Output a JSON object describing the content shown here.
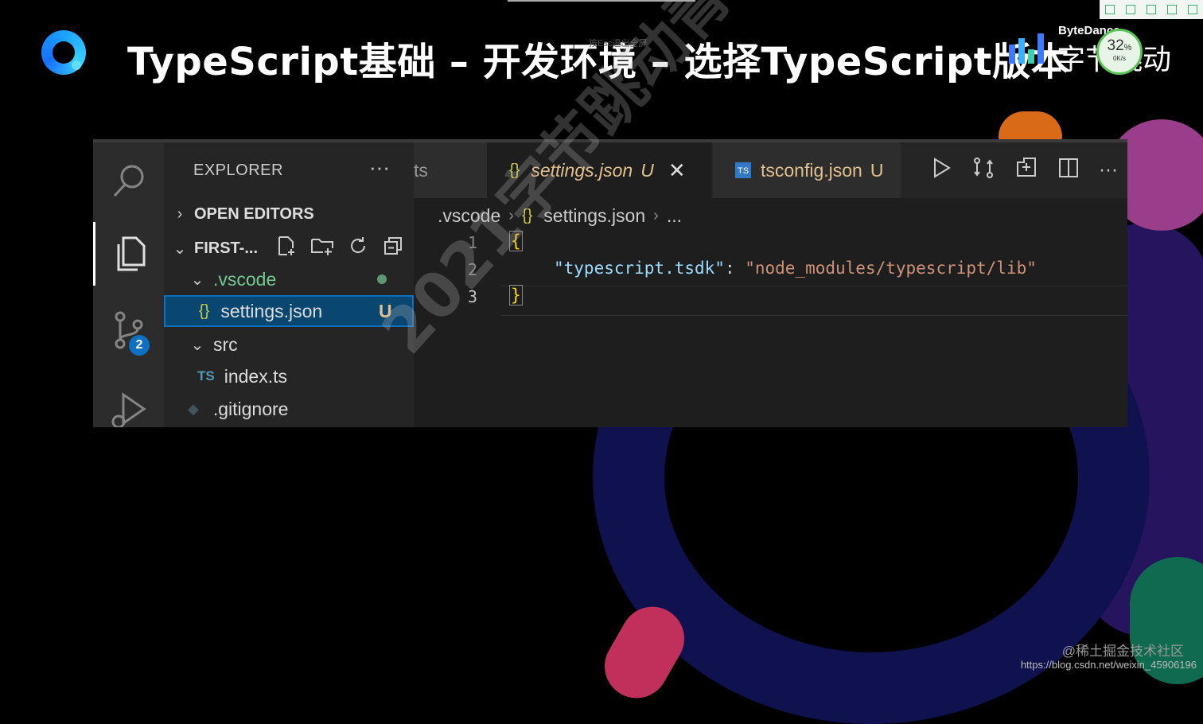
{
  "slide": {
    "title": "TypeScript基础 – 开发环境 – 选择TypeScript版本",
    "ghost_text": "按Esc退出全屏",
    "brand_en": "ByteDance",
    "brand_cn": "字节跳动",
    "speed_badge": {
      "percent": "32",
      "percent_unit": "%",
      "rate": "0K/s"
    },
    "watermark": "2021字节跳动青训营",
    "footer_community": "@稀土掘金技术社区",
    "footer_url": "https://blog.csdn.net/weixin_45906196"
  },
  "activity_bar": {
    "items": [
      {
        "name": "search",
        "icon": "search-icon"
      },
      {
        "name": "explorer",
        "icon": "files-icon",
        "active": true
      },
      {
        "name": "source-control",
        "icon": "source-control-icon",
        "badge": "2"
      },
      {
        "name": "run-debug",
        "icon": "run-debug-icon"
      }
    ]
  },
  "explorer": {
    "title": "EXPLORER",
    "more": "···",
    "open_editors": "OPEN EDITORS",
    "folder": "FIRST-...",
    "tree": [
      {
        "label": ".vscode",
        "type": "folder",
        "expanded": true,
        "color": "#73c991"
      },
      {
        "label": "settings.json",
        "type": "json",
        "status": "U",
        "selected": true
      },
      {
        "label": "src",
        "type": "folder",
        "expanded": true
      },
      {
        "label": "index.ts",
        "type": "ts",
        "icon_text": "TS"
      },
      {
        "label": ".gitignore",
        "type": "git"
      }
    ]
  },
  "editor": {
    "tabs": [
      {
        "label": "ts",
        "active": false
      },
      {
        "label": "settings.json",
        "status": "U",
        "active": true,
        "icon_text": "{}"
      },
      {
        "label": "tsconfig.json",
        "status": "U",
        "active": false,
        "icon_text": "TS"
      }
    ],
    "breadcrumb": [
      ".vscode",
      "settings.json",
      "..."
    ],
    "breadcrumb_icon": "{}",
    "lines": [
      {
        "number": "1",
        "text": "{"
      },
      {
        "number": "2",
        "key": "\"typescript.tsdk\"",
        "colon": ": ",
        "value": "\"node_modules/typescript/lib\""
      },
      {
        "number": "3",
        "text": "}"
      }
    ]
  },
  "colors": {
    "background": "#000000",
    "sidebar": "#252526",
    "editor": "#1e1e1e",
    "selection": "#094771",
    "accent": "#0e70c0",
    "json_key": "#9cdcfe",
    "json_string": "#ce9178",
    "untracked": "#e2c08d"
  }
}
